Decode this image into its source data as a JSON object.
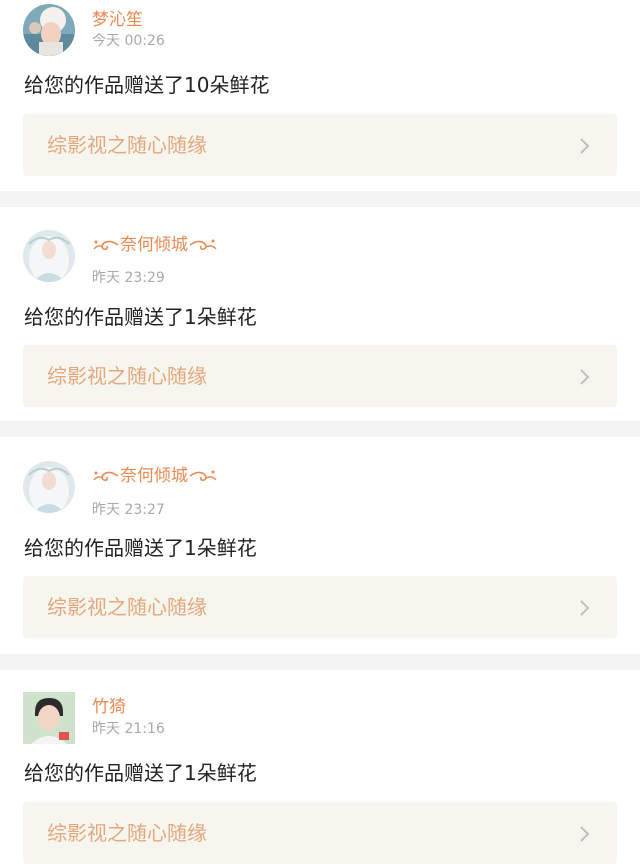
{
  "colors": {
    "username": "#e98a54",
    "timestamp": "#a9a9a9",
    "message": "#222222",
    "work_title": "#e5a77d",
    "card_bg": "#f6f6ef",
    "separator": "#f4f4f4"
  },
  "notifications": [
    {
      "username": "梦沁笙",
      "decorated_name": false,
      "time": "今天 00:26",
      "message": "给您的作品赠送了10朵鲜花",
      "work_title": "综影视之随心随缘",
      "avatar_icon": "avatar-girl-white-cap"
    },
    {
      "username": "奈何倾城",
      "decorated_name": true,
      "time": "昨天 23:29",
      "message": "给您的作品赠送了1朵鲜花",
      "work_title": "综影视之随心随缘",
      "avatar_icon": "avatar-white-hair-fairy"
    },
    {
      "username": "奈何倾城",
      "decorated_name": true,
      "time": "昨天 23:27",
      "message": "给您的作品赠送了1朵鲜花",
      "work_title": "综影视之随心随缘",
      "avatar_icon": "avatar-white-hair-fairy"
    },
    {
      "username": "竹猗",
      "decorated_name": false,
      "time": "昨天 21:16",
      "message": "给您的作品赠送了1朵鲜花",
      "work_title": "综影视之随心随缘",
      "avatar_icon": "avatar-boy-portrait"
    }
  ]
}
